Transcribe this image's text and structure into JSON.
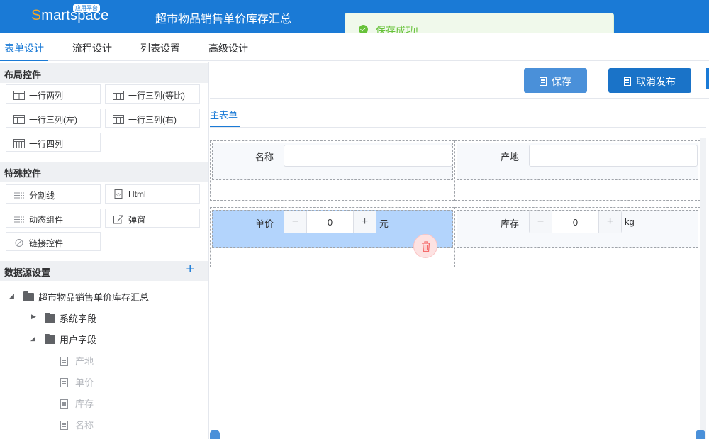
{
  "app": {
    "logo_first": "S",
    "logo_rest": "martspace",
    "logo_badge": "应用平台",
    "title": "超市物品销售单价库存汇总"
  },
  "toast": {
    "message": "保存成功!"
  },
  "tabs": [
    {
      "label": "表单设计",
      "active": true
    },
    {
      "label": "流程设计"
    },
    {
      "label": "列表设置"
    },
    {
      "label": "高级设计"
    }
  ],
  "sidebar": {
    "layout_title": "布局控件",
    "layout_items": [
      "一行两列",
      "一行三列(等比)",
      "一行三列(左)",
      "一行三列(右)",
      "一行四列"
    ],
    "special_title": "特殊控件",
    "special_items": [
      "分割线",
      "Html",
      "动态组件",
      "弹窗",
      "链接控件"
    ],
    "datasource_title": "数据源设置",
    "datasource_add": "+",
    "tree": {
      "root": "超市物品销售单价库存汇总",
      "system": "系统字段",
      "user": "用户字段",
      "user_fields": [
        "产地",
        "单价",
        "库存",
        "名称"
      ]
    }
  },
  "toolbar": {
    "save_label": "保存",
    "unpublish_label": "取消发布"
  },
  "form": {
    "tab_label": "主表单",
    "fields": {
      "name_label": "名称",
      "origin_label": "产地",
      "price_label": "单价",
      "price_value": "0",
      "price_unit": "元",
      "stock_label": "库存",
      "stock_value": "0",
      "stock_unit": "kg",
      "minus": "−",
      "plus": "+"
    }
  },
  "colors": {
    "brand": "#1a7ad6",
    "success": "#67c23a",
    "selected": "#b3d4fc"
  }
}
